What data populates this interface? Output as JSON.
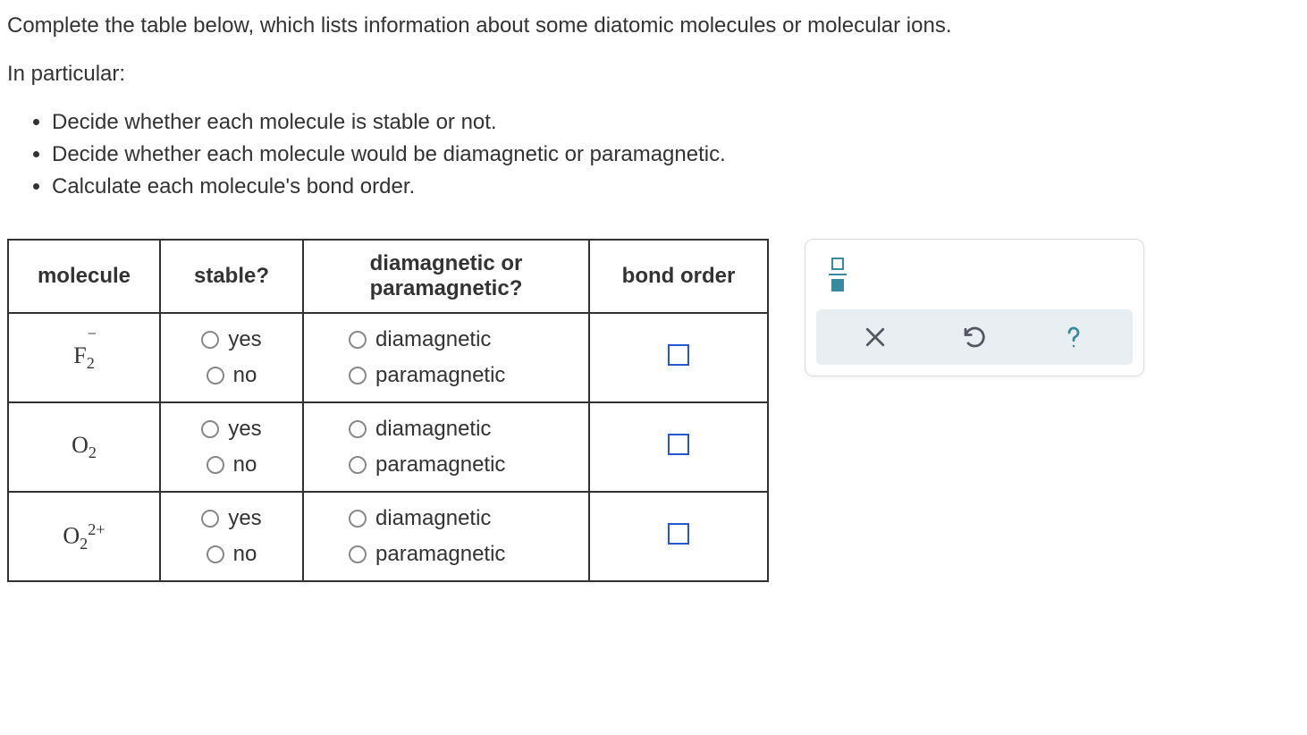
{
  "intro_line1": "Complete the table below, which lists information about some diatomic molecules or molecular ions.",
  "intro_line2": "In particular:",
  "bullets": [
    "Decide whether each molecule is stable or not.",
    "Decide whether each molecule would be diamagnetic or paramagnetic.",
    "Calculate each molecule's bond order."
  ],
  "headers": {
    "molecule": "molecule",
    "stable": "stable?",
    "magnetic": "diamagnetic or paramagnetic?",
    "bond_order": "bond order"
  },
  "options": {
    "yes": "yes",
    "no": "no",
    "dia": "diamagnetic",
    "para": "paramagnetic"
  },
  "rows": [
    {
      "base": "F",
      "sub": "2",
      "sup": "−",
      "sup_pos": "pre"
    },
    {
      "base": "O",
      "sub": "2",
      "sup": "",
      "sup_pos": ""
    },
    {
      "base": "O",
      "sub": "2",
      "sup": "2+",
      "sup_pos": "post"
    }
  ]
}
